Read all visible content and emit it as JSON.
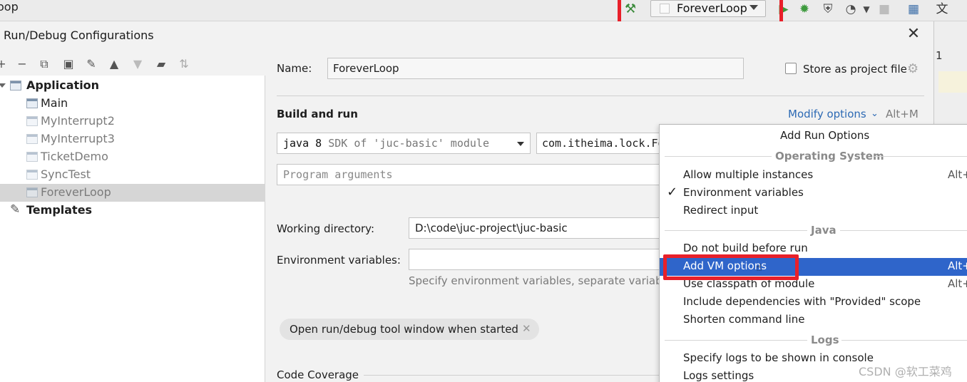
{
  "ide": {
    "title": "oop",
    "run_config": "ForeverLoop"
  },
  "dialog": {
    "title": "Run/Debug Configurations",
    "close": "✕"
  },
  "right_strip": {
    "text": "1"
  },
  "tree": {
    "application": "Application",
    "items": [
      {
        "label": "Main"
      },
      {
        "label": "MyInterrupt2"
      },
      {
        "label": "MyInterrupt3"
      },
      {
        "label": "TicketDemo"
      },
      {
        "label": "SyncTest"
      },
      {
        "label": "ForeverLoop"
      }
    ],
    "templates": "Templates"
  },
  "form": {
    "name_label": "Name:",
    "name_value": "ForeverLoop",
    "store_label": "Store as project file",
    "build_run": "Build and run",
    "modify_options": "Modify options",
    "modify_shortcut": "Alt+M",
    "jdk_main": "java 8",
    "jdk_hint": "SDK of 'juc-basic' module",
    "main_class": "com.itheima.lock.Fo",
    "program_args_placeholder": "Program arguments",
    "workdir_label": "Working directory:",
    "workdir_value": "D:\\code\\juc-project\\juc-basic",
    "envvars_label": "Environment variables:",
    "envvars_hint": "Specify environment variables, separate variables",
    "open_tool_chip": "Open run/debug tool window when started",
    "code_coverage": "Code Coverage"
  },
  "popup": {
    "title": "Add Run Options",
    "groups": {
      "os": "Operating System",
      "java": "Java",
      "logs": "Logs"
    },
    "items": [
      {
        "label": "Allow multiple instances",
        "shortcut": "Alt+"
      },
      {
        "label": "Environment variables",
        "shortcut": ""
      },
      {
        "label": "Redirect input",
        "shortcut": ""
      },
      {
        "label": "Do not build before run",
        "shortcut": ""
      },
      {
        "label": "Add VM options",
        "shortcut": "Alt+"
      },
      {
        "label": "Use classpath of module",
        "shortcut": "Alt+"
      },
      {
        "label": "Include dependencies with \"Provided\" scope",
        "shortcut": ""
      },
      {
        "label": "Shorten command line",
        "shortcut": ""
      },
      {
        "label": "Specify logs to be shown in console",
        "shortcut": ""
      },
      {
        "label": "Logs settings",
        "shortcut": ""
      }
    ]
  },
  "watermark": "CSDN @软工菜鸡",
  "colors": {
    "highlight": "#2f65ca",
    "link": "#2d6ab4",
    "annotation": "#e8202a"
  }
}
